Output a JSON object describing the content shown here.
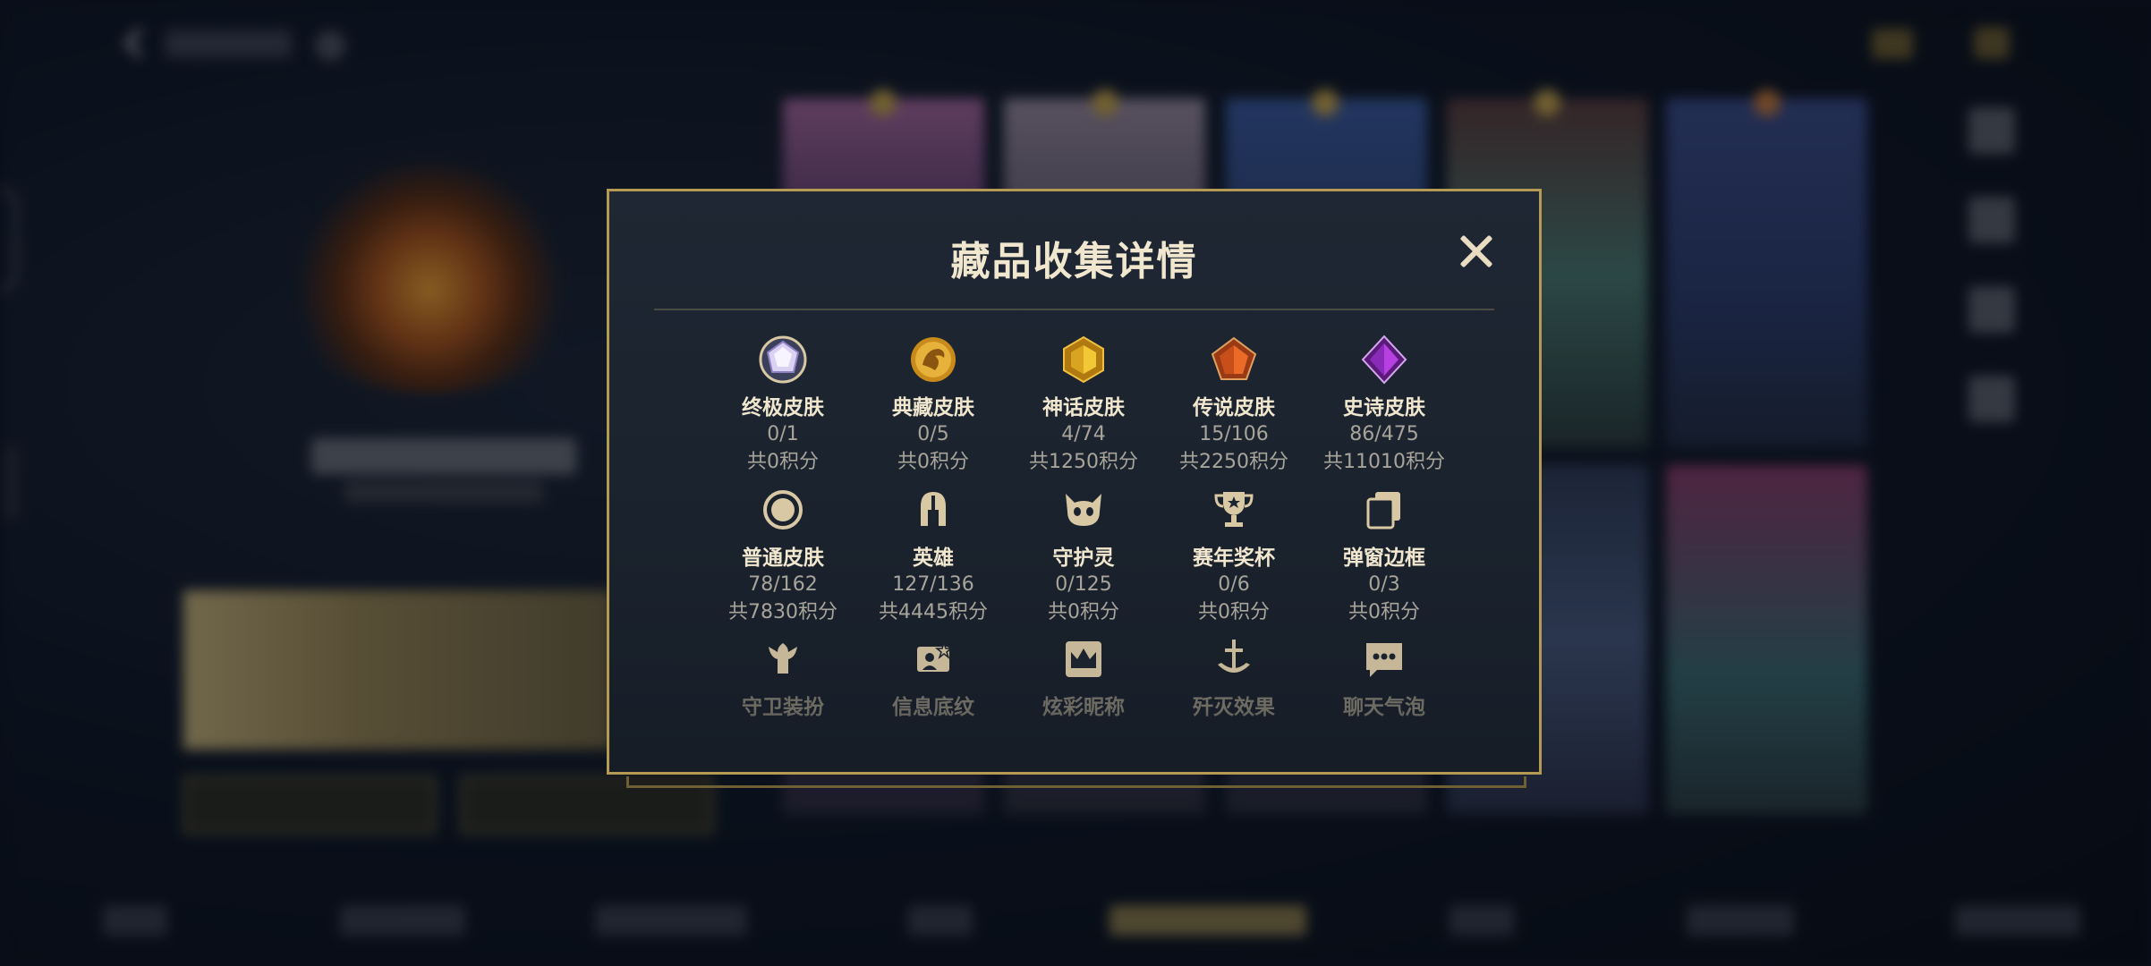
{
  "modal": {
    "title": "藏品收集详情",
    "items": [
      {
        "label": "终极皮肤",
        "count": "0/1",
        "points": "共0积分",
        "icon": "white-gem-icon"
      },
      {
        "label": "典藏皮肤",
        "count": "0/5",
        "points": "共0积分",
        "icon": "golden-dragon-icon"
      },
      {
        "label": "神话皮肤",
        "count": "4/74",
        "points": "共1250积分",
        "icon": "gold-gem-icon"
      },
      {
        "label": "传说皮肤",
        "count": "15/106",
        "points": "共2250积分",
        "icon": "orange-gem-icon"
      },
      {
        "label": "史诗皮肤",
        "count": "86/475",
        "points": "共11010积分",
        "icon": "purple-gem-icon"
      },
      {
        "label": "普通皮肤",
        "count": "78/162",
        "points": "共7830积分",
        "icon": "ring-icon"
      },
      {
        "label": "英雄",
        "count": "127/136",
        "points": "共4445积分",
        "icon": "helmet-icon"
      },
      {
        "label": "守护灵",
        "count": "0/125",
        "points": "共0积分",
        "icon": "guardian-icon"
      },
      {
        "label": "赛年奖杯",
        "count": "0/6",
        "points": "共0积分",
        "icon": "trophy-icon"
      },
      {
        "label": "弹窗边框",
        "count": "0/3",
        "points": "共0积分",
        "icon": "frame-icon"
      },
      {
        "label": "守卫装扮",
        "icon": "ward-icon"
      },
      {
        "label": "信息底纹",
        "icon": "profile-card-icon"
      },
      {
        "label": "炫彩昵称",
        "icon": "crown-icon"
      },
      {
        "label": "歼灭效果",
        "icon": "sword-icon"
      },
      {
        "label": "聊天气泡",
        "icon": "chat-bubble-icon"
      }
    ]
  },
  "colors": {
    "gold_border": "#b49a52",
    "title_text": "#f1e7cf",
    "muted_text": "#a8a49a",
    "icon_tan": "#d8c8a4"
  }
}
